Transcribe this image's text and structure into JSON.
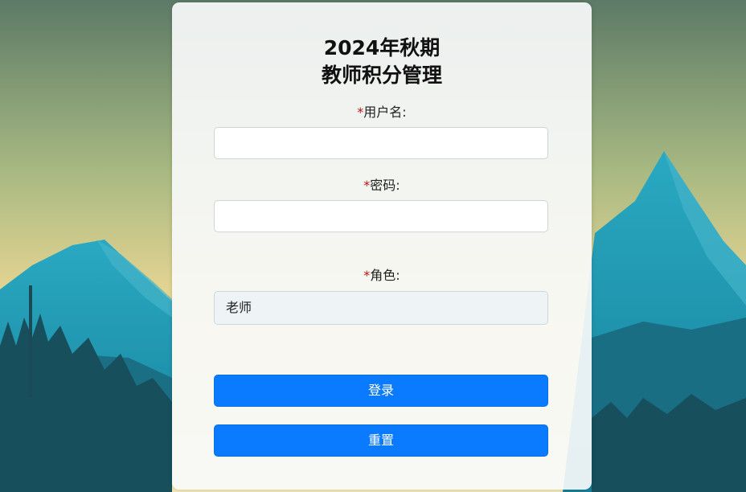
{
  "form": {
    "title_line1": "2024年秋期",
    "title_line2": "教师积分管理",
    "required_mark": "*",
    "username_label": "用户名:",
    "username_value": "",
    "password_label": "密码:",
    "password_value": "",
    "role_label": "角色:",
    "role_selected": "老师",
    "login_label": "登录",
    "reset_label": "重置"
  },
  "colors": {
    "accent": "#0a7bff",
    "required": "#b81414",
    "sky_top": "#5f7f6a",
    "sky_bottom": "#e9d797",
    "mountain": "#1f9db8",
    "forest": "#15505e"
  }
}
